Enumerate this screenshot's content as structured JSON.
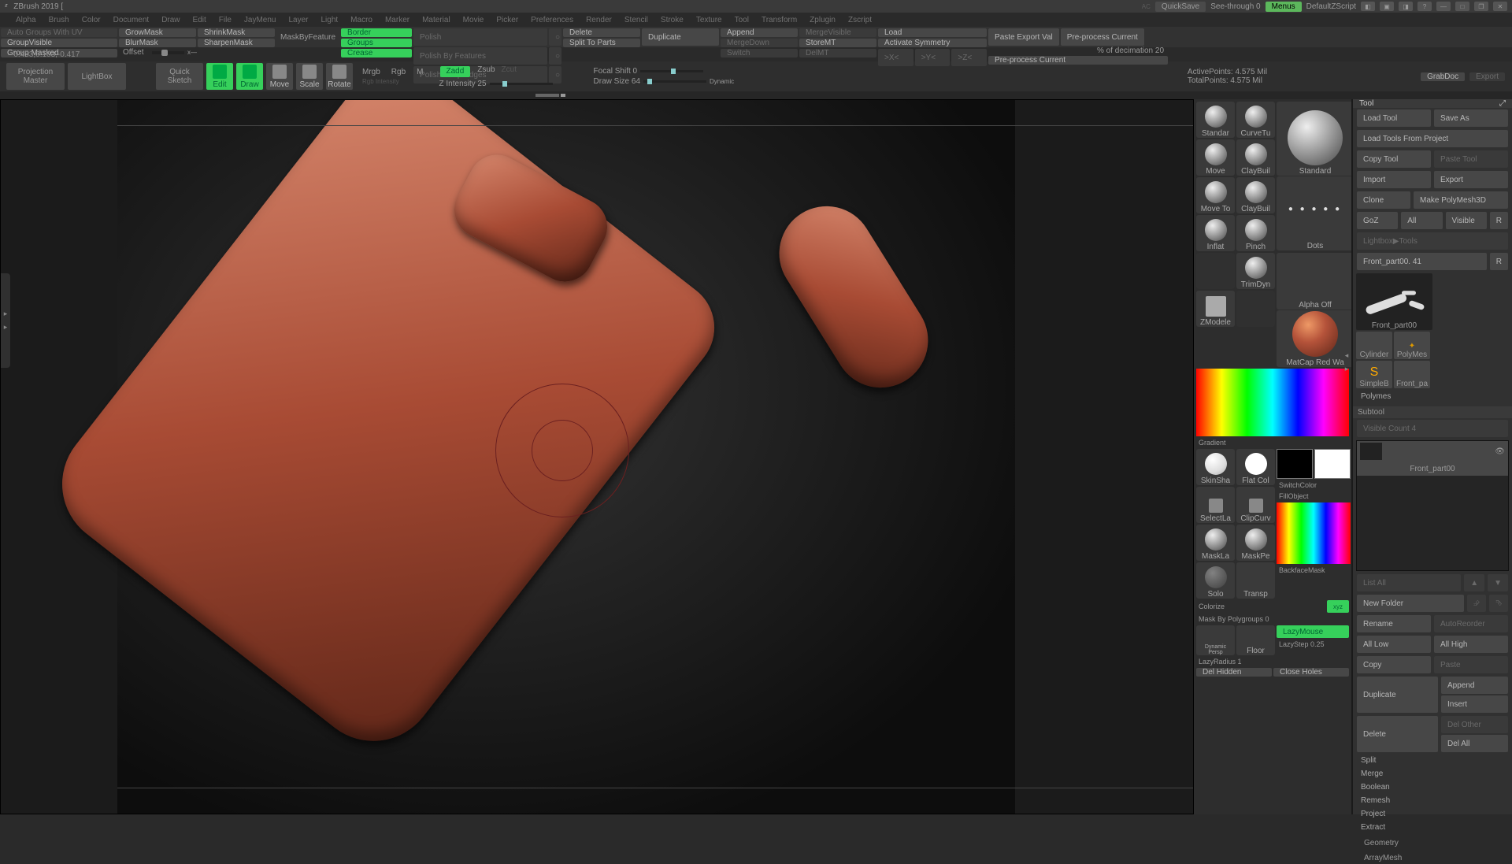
{
  "title": "ZBrush 2019 [",
  "titlebar_right": {
    "ac": "AC",
    "quicksave": "QuickSave",
    "seethrough": "See-through  0",
    "menus": "Menus",
    "zscript": "DefaultZScript"
  },
  "menu": [
    "Alpha",
    "Brush",
    "Color",
    "Document",
    "Draw",
    "Edit",
    "File",
    "JayMenu",
    "Layer",
    "Light",
    "Macro",
    "Marker",
    "Material",
    "Movie",
    "Picker",
    "Preferences",
    "Render",
    "Stencil",
    "Stroke",
    "Texture",
    "Tool",
    "Transform",
    "Zplugin",
    "Zscript"
  ],
  "shelf": {
    "r1c1": "Auto Groups With UV",
    "r2c1": "GroupVisible",
    "r3c1": "Group Masked",
    "r1c2": "GrowMask",
    "r2c2": "BlurMask",
    "offset_lbl": "Offset",
    "offset_x": "x",
    "r1c3": "ShrinkMask",
    "r2c3": "SharpenMask",
    "maskbyfeature": "MaskByFeature",
    "border": "Border",
    "groups": "Groups",
    "crease": "Crease",
    "polish": "Polish",
    "polishbyfeat": "Polish By Features",
    "polishcrisp": "Polish Crisp Edges",
    "delete": "Delete",
    "duplicate": "Duplicate",
    "split": "Split To Parts",
    "append": "Append",
    "mergedown": "MergeDown",
    "switch": "Switch",
    "mergevisible": "MergeVisible",
    "storemt": "StoreMT",
    "delmt": "DelMT",
    "load": "Load",
    "activatesym": "Activate Symmetry",
    "x": ">X<",
    "y": ">Y<",
    "z": ">Z<",
    "pasteexport": "Paste Export Val",
    "preprocess": "Pre-process Current",
    "decim": "% of decimation 20",
    "preprocess2": "Pre-process Current"
  },
  "coords": "-0.453,0.103,-0.417",
  "toolbar": {
    "projection": "Projection\nMaster",
    "lightbox": "LightBox",
    "quicksketch": "Quick\nSketch",
    "edit": "Edit",
    "draw": "Draw",
    "move": "Move",
    "scale": "Scale",
    "rotate": "Rotate",
    "mrgb": "Mrgb",
    "rgb": "Rgb",
    "m": "M",
    "rgbint": "Rgb Intensity",
    "zadd": "Zadd",
    "zsub": "Zsub",
    "zcut": "Zcut",
    "zint": "Z Intensity 25",
    "focal": "Focal Shift 0",
    "dsize": "Draw Size 64",
    "dynamic": "Dynamic",
    "active": "ActivePoints: 4.575 Mil",
    "total": "TotalPoints: 4.575 Mil",
    "grabdoc": "GrabDoc",
    "export": "Export"
  },
  "brushes": {
    "row1": [
      "Standar",
      "CurveTu"
    ],
    "row2": [
      "Move",
      "ClayBuil"
    ],
    "row3": [
      "Move To",
      "ClayBuil"
    ],
    "row4": [
      "Inflat",
      "Pinch"
    ],
    "trimdyn": "TrimDyn",
    "zmodel": "ZModele",
    "big": "Standard",
    "dots": "Dots",
    "alphaoff": "Alpha Off",
    "matcap": "MatCap Red Wa",
    "gradient": "Gradient",
    "switchcolor": "SwitchColor",
    "fillobj": "FillObject",
    "skinsha": "SkinSha",
    "flatcol": "Flat Col",
    "selectla": "SelectLa",
    "clipcurv": "ClipCurv",
    "maskla": "MaskLa",
    "maskpe": "MaskPe",
    "solo": "Solo",
    "transp": "Transp",
    "backface": "BackfaceMask",
    "colorize": "Colorize",
    "maskpoly": "Mask By Polygroups 0",
    "dynpersp": "Dynamic\nPersp",
    "floor": "Floor",
    "lazymouse": "LazyMouse",
    "lazystep": "LazyStep 0.25",
    "lazyrad": "LazyRadius 1",
    "delhidden": "Del Hidden",
    "closeholes": "Close Holes",
    "xyz": "xyz"
  },
  "tool": {
    "title": "Tool",
    "load": "Load Tool",
    "saveas": "Save As",
    "loadproj": "Load Tools From Project",
    "copy": "Copy Tool",
    "paste": "Paste Tool",
    "import": "Import",
    "export": "Export",
    "clone": "Clone",
    "makepoly": "Make PolyMesh3D",
    "goz": "GoZ",
    "all": "All",
    "visible": "Visible",
    "r": "R",
    "lightbox": "Lightbox▶Tools",
    "toolname": "Front_part00. 41",
    "thumbs": [
      "Front_part00",
      "Cylinder",
      "PolyMes",
      "SimpleB",
      "Front_pa"
    ],
    "polymes": "Polymes",
    "subtool": "Subtool",
    "viscount": "Visible Count 4",
    "subitem": "Front_part00",
    "listall": "List All",
    "newfolder": "New Folder",
    "rename": "Rename",
    "autoreorder": "AutoReorder",
    "alllow": "All Low",
    "allhigh": "All High",
    "copy2": "Copy",
    "paste2": "Paste",
    "dup": "Duplicate",
    "append2": "Append",
    "insert": "Insert",
    "del": "Delete",
    "delother": "Del Other",
    "delall": "Del All",
    "split": "Split",
    "merge": "Merge",
    "boolean": "Boolean",
    "remesh": "Remesh",
    "project": "Project",
    "extract": "Extract",
    "geometry": "Geometry",
    "arraymesh": "ArrayMesh"
  }
}
